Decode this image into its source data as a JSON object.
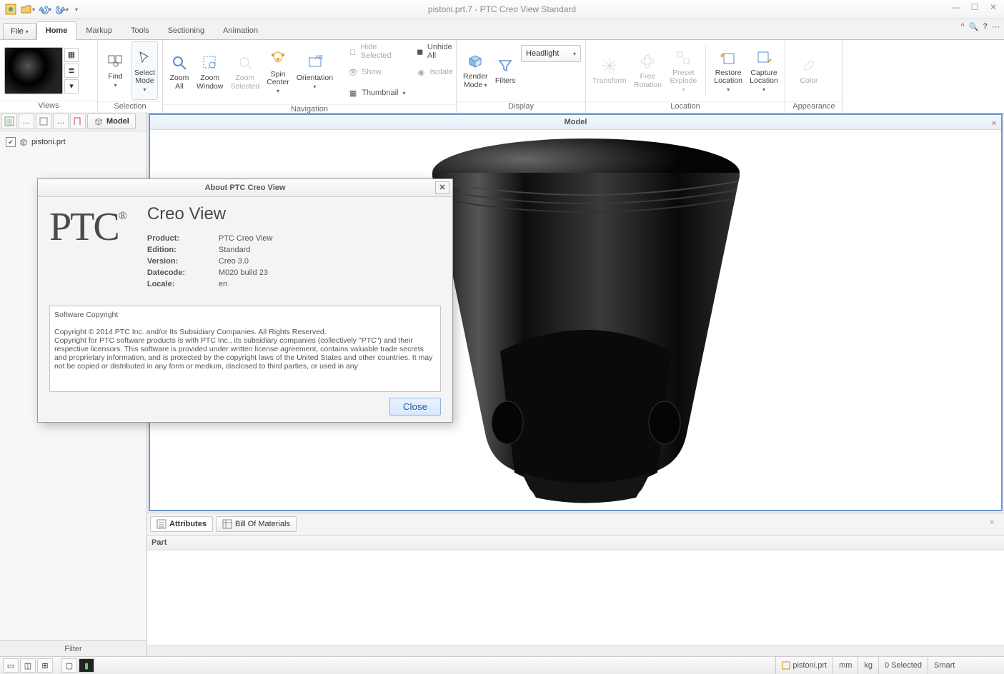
{
  "window": {
    "title": "pistoni.prt.7 - PTC Creo View Standard"
  },
  "menu": {
    "file": "File",
    "tabs": [
      "Home",
      "Markup",
      "Tools",
      "Sectioning",
      "Animation"
    ]
  },
  "ribbon": {
    "groups": {
      "views": "Views",
      "selection": "Selection",
      "navigation": "Navigation",
      "display": "Display",
      "location": "Location",
      "appearance": "Appearance"
    },
    "find": "Find",
    "select_mode": "Select Mode",
    "zoom_all": "Zoom All",
    "zoom_window": "Zoom Window",
    "zoom_selected": "Zoom Selected",
    "spin_center": "Spin Center",
    "orientation": "Orientation",
    "hide_selected": "Hide Selected",
    "unhide_all": "Unhide All",
    "show": "Show",
    "isolate": "Isolate",
    "thumbnail": "Thumbnail",
    "render_mode": "Render Mode",
    "filters": "Filters",
    "headlight": "Headlight",
    "transform": "Transform",
    "free_rotation": "Free Rotation",
    "preset_explode": "Preset Explode",
    "restore_location": "Restore Location",
    "capture_location": "Capture Location",
    "color": "Color"
  },
  "tree": {
    "model_tab": "Model",
    "root": "pistoni.prt"
  },
  "canvas": {
    "title": "Model"
  },
  "btabs": {
    "attributes": "Attributes",
    "bom": "Bill Of Materials",
    "col": "Part"
  },
  "filter": "Filter",
  "status": {
    "file": "pistoni.prt",
    "unit_len": "mm",
    "unit_mass": "kg",
    "selected": "0 Selected",
    "mode": "Smart"
  },
  "dialog": {
    "title": "About PTC Creo View",
    "brand": "PTC",
    "heading": "Creo View",
    "rows": {
      "product_k": "Product:",
      "product_v": "PTC Creo View",
      "edition_k": "Edition:",
      "edition_v": "Standard",
      "version_k": "Version:",
      "version_v": "Creo 3.0",
      "datecode_k": "Datecode:",
      "datecode_v": "M020 build 23",
      "locale_k": "Locale:",
      "locale_v": "en"
    },
    "copy_header": "Software Copyright",
    "copy_body": "Copyright © 2014 PTC Inc. and/or Its Subsidiary Companies. All Rights Reserved.\nCopyright for PTC software products is with PTC Inc., its subsidiary companies (collectively \"PTC\") and their respective licensors. This software is provided under written license agreement, contains valuable trade secrets and proprietary information, and is protected by the copyright laws of the United States and other countries. It may not be copied or distributed in any form or medium, disclosed to third parties, or used in any",
    "close": "Close"
  }
}
